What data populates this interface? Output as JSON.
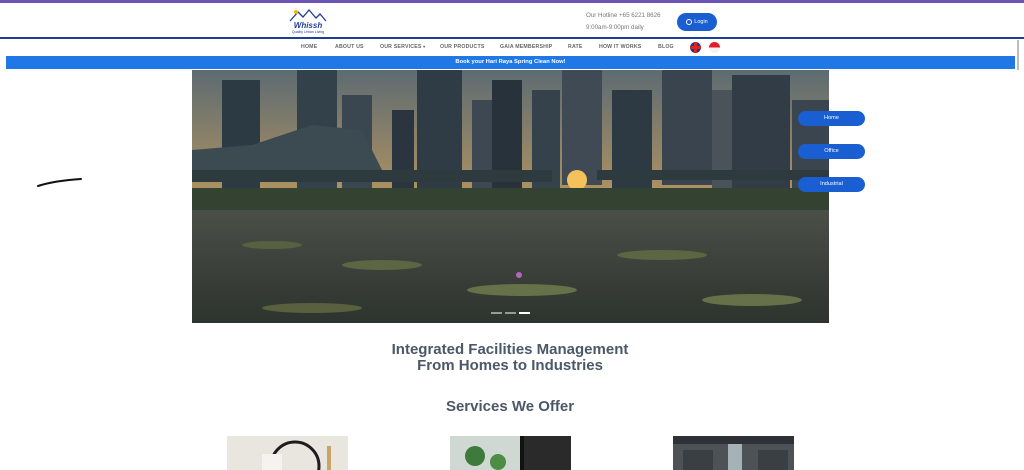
{
  "header": {
    "logo_text": "Whissh",
    "logo_tagline": "Quality Urban Living",
    "hotline": "Our Hotline +65 6221 8626",
    "hours": "9:00am-9:00pm daily",
    "login_label": "Login"
  },
  "nav": {
    "items": [
      {
        "label": "HOME"
      },
      {
        "label": "ABOUT US"
      },
      {
        "label": "OUR SERVICES"
      },
      {
        "label": "OUR PRODUCTS"
      },
      {
        "label": "GAIA MEMBERSHIP"
      },
      {
        "label": "RATE"
      },
      {
        "label": "HOW IT WORKS"
      },
      {
        "label": "BLOG"
      }
    ],
    "dropdown_glyph": "▾",
    "flags": [
      "uk-flag-icon",
      "sg-flag-icon"
    ]
  },
  "promo": {
    "text": "Book your Hari Raya Spring Clean Now!"
  },
  "hero": {
    "side_buttons": [
      {
        "label": "Home"
      },
      {
        "label": "Office"
      },
      {
        "label": "Industrial"
      }
    ],
    "slide_count": 3,
    "active_slide": 2
  },
  "main": {
    "headline_line1": "Integrated Facilities Management",
    "headline_line2": "From Homes to Industries",
    "services_title": "Services We Offer"
  },
  "colors": {
    "accent_blue": "#1a5fd1",
    "promo_blue": "#1f78e6",
    "nav_line": "#1e3f8f",
    "heading": "#4b5868"
  }
}
